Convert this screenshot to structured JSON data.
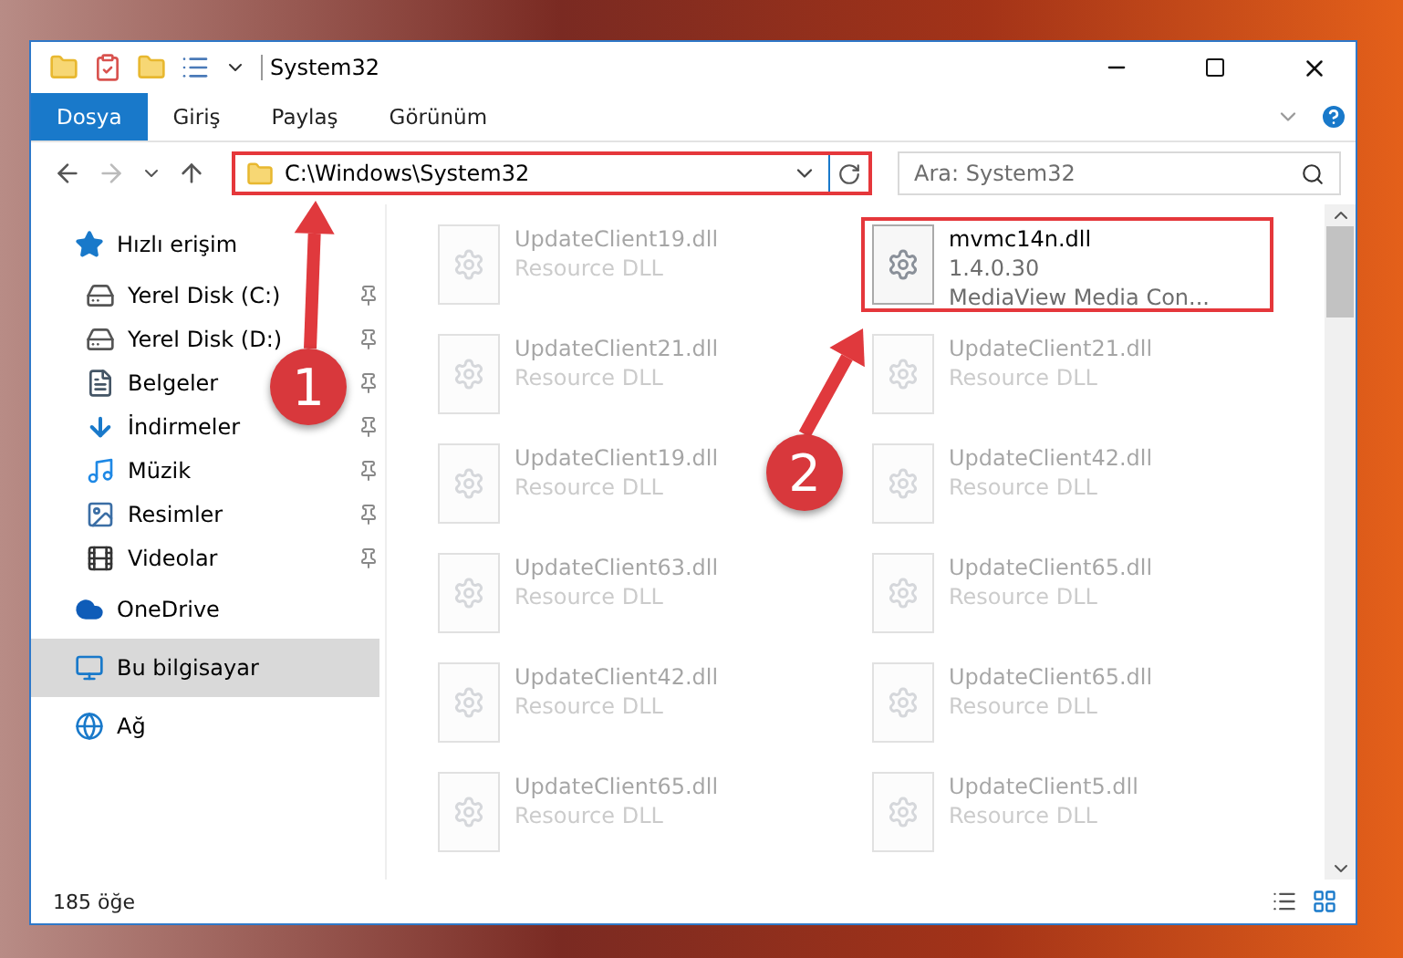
{
  "window": {
    "title": "System32"
  },
  "ribbon_tabs": [
    {
      "label": "Dosya",
      "selected": true
    },
    {
      "label": "Giriş",
      "selected": false
    },
    {
      "label": "Paylaş",
      "selected": false
    },
    {
      "label": "Görünüm",
      "selected": false
    }
  ],
  "address": {
    "value": "C:\\Windows\\System32",
    "highlighted": true
  },
  "search": {
    "placeholder": "Ara: System32"
  },
  "sidebar": {
    "items": [
      {
        "label": "Hızlı erişim",
        "kind": "star",
        "selected": false,
        "children": [
          {
            "label": "Yerel Disk (C:)",
            "kind": "system-drive",
            "selected": false
          },
          {
            "label": "Yerel Disk (D:)",
            "kind": "drive",
            "selected": false
          },
          {
            "label": "Belgeler",
            "kind": "documents",
            "selected": false
          },
          {
            "label": "İndirmeler",
            "kind": "downloads",
            "selected": false
          },
          {
            "label": "Müzik",
            "kind": "music",
            "selected": false
          },
          {
            "label": "Resimler",
            "kind": "pictures",
            "selected": false
          },
          {
            "label": "Videolar",
            "kind": "videos",
            "selected": false
          }
        ]
      },
      {
        "label": "OneDrive",
        "kind": "cloud",
        "selected": false
      },
      {
        "label": "Bu bilgisayar",
        "kind": "computer",
        "selected": true
      },
      {
        "label": "Ağ",
        "kind": "network",
        "selected": false
      }
    ]
  },
  "files": [
    {
      "name": "UpdateClient19.dll",
      "details": [
        "Resource DLL"
      ],
      "highlighted": false
    },
    {
      "name": "mvmc14n.dll",
      "details": [
        "1.4.0.30",
        "MediaView Media Con..."
      ],
      "highlighted": true
    },
    {
      "name": "UpdateClient21.dll",
      "details": [
        "Resource DLL"
      ],
      "highlighted": false
    },
    {
      "name": "UpdateClient21.dll",
      "details": [
        "Resource DLL"
      ],
      "highlighted": false
    },
    {
      "name": "UpdateClient19.dll",
      "details": [
        "Resource DLL"
      ],
      "highlighted": false
    },
    {
      "name": "UpdateClient42.dll",
      "details": [
        "Resource DLL"
      ],
      "highlighted": false
    },
    {
      "name": "UpdateClient63.dll",
      "details": [
        "Resource DLL"
      ],
      "highlighted": false
    },
    {
      "name": "UpdateClient65.dll",
      "details": [
        "Resource DLL"
      ],
      "highlighted": false
    },
    {
      "name": "UpdateClient42.dll",
      "details": [
        "Resource DLL"
      ],
      "highlighted": false
    },
    {
      "name": "UpdateClient65.dll",
      "details": [
        "Resource DLL"
      ],
      "highlighted": false
    },
    {
      "name": "UpdateClient65.dll",
      "details": [
        "Resource DLL"
      ],
      "highlighted": false
    },
    {
      "name": "UpdateClient5.dll",
      "details": [
        "Resource DLL"
      ],
      "highlighted": false
    }
  ],
  "status_bar": {
    "count": "185 öğe"
  },
  "annotations": [
    {
      "number": "1"
    },
    {
      "number": "2"
    }
  ]
}
